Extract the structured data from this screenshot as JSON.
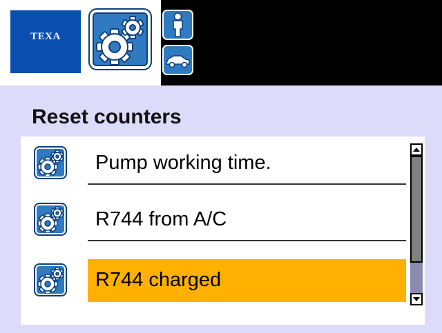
{
  "header": {
    "logo_text": "TEXA",
    "tabs": [
      {
        "icon": "gears-icon",
        "active": true
      },
      {
        "icon": "person-icon",
        "active": false
      },
      {
        "icon": "car-icon",
        "active": false
      }
    ]
  },
  "main": {
    "title": "Reset counters",
    "items": [
      {
        "label": "Pump working time.",
        "icon": "gears-icon",
        "selected": false
      },
      {
        "label": "R744 from A/C",
        "icon": "gears-icon",
        "selected": false
      },
      {
        "label": "R744 charged",
        "icon": "gears-icon",
        "selected": true
      }
    ],
    "scroll_position_fraction": 0.0,
    "scroll_visible_fraction": 0.78
  },
  "colors": {
    "brand_blue": "#0a4fb0",
    "icon_blue": "#2f7ac0",
    "background": "#dcdcfa",
    "selection": "#ffb000"
  }
}
